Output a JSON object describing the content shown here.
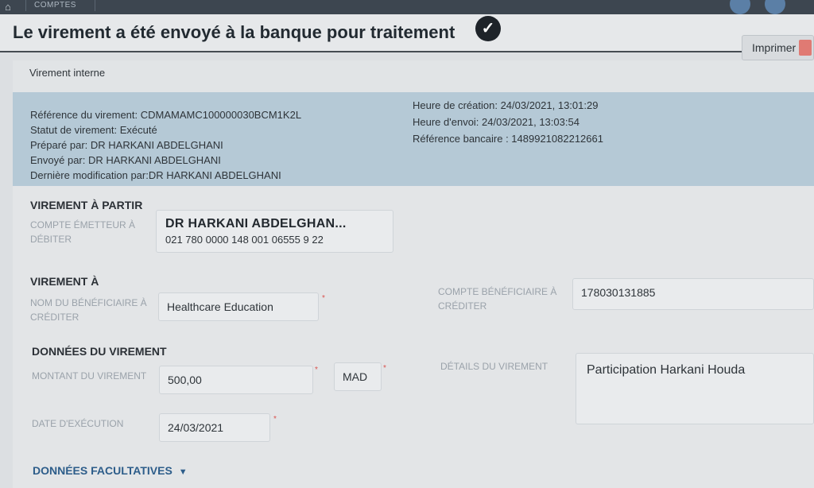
{
  "topbar": {
    "home_icon": "bank-icon",
    "tab_label": "COMPTES"
  },
  "header": {
    "title": "Le virement a été envoyé à la banque pour traitement",
    "check_icon": "check-circle-icon"
  },
  "print": {
    "label": "Imprimer",
    "icon": "printer-icon"
  },
  "transfer_type": "Virement interne",
  "info": {
    "reference": "Référence du virement: CDMAMAMC100000030BCM1K2L",
    "status": "Statut de virement: Exécuté",
    "prepared_by": "Préparé par: DR HARKANI ABDELGHANI",
    "sent_by": "Envoyé par: DR HARKANI ABDELGHANI",
    "last_modified_by": "Dernière modification par:DR HARKANI ABDELGHANI",
    "created_at": "Heure de création: 24/03/2021, 13:01:29",
    "sent_at": "Heure d'envoi: 24/03/2021, 13:03:54",
    "bank_reference": "Référence bancaire : 1489921082212661"
  },
  "from": {
    "section_title": "VIREMENT À PARTIR",
    "label": "COMPTE ÉMETTEUR À DÉBITER",
    "account_name": "DR HARKANI ABDELGHAN...",
    "account_number": "021 780 0000 148 001 06555 9 22"
  },
  "to": {
    "section_title": "VIREMENT À",
    "beneficiary_label": "NOM DU BÉNÉFICIAIRE À CRÉDITER",
    "beneficiary_value": "Healthcare Education",
    "account_label": "COMPTE BÉNÉFICIAIRE À CRÉDITER",
    "account_value": "178030131885"
  },
  "transfer": {
    "section_title": "DONNÉES DU VIREMENT",
    "amount_label": "MONTANT DU VIREMENT",
    "amount_value": "500,00",
    "currency": "MAD",
    "details_label": "DÉTAILS DU VIREMENT",
    "details_value": "Participation Harkani Houda",
    "date_label": "DATE D'EXÉCUTION",
    "date_value": "24/03/2021"
  },
  "optional": {
    "section_title": "DONNÉES FACULTATIVES",
    "toggle_icon": "caret-down-icon"
  },
  "required_mark": "*"
}
